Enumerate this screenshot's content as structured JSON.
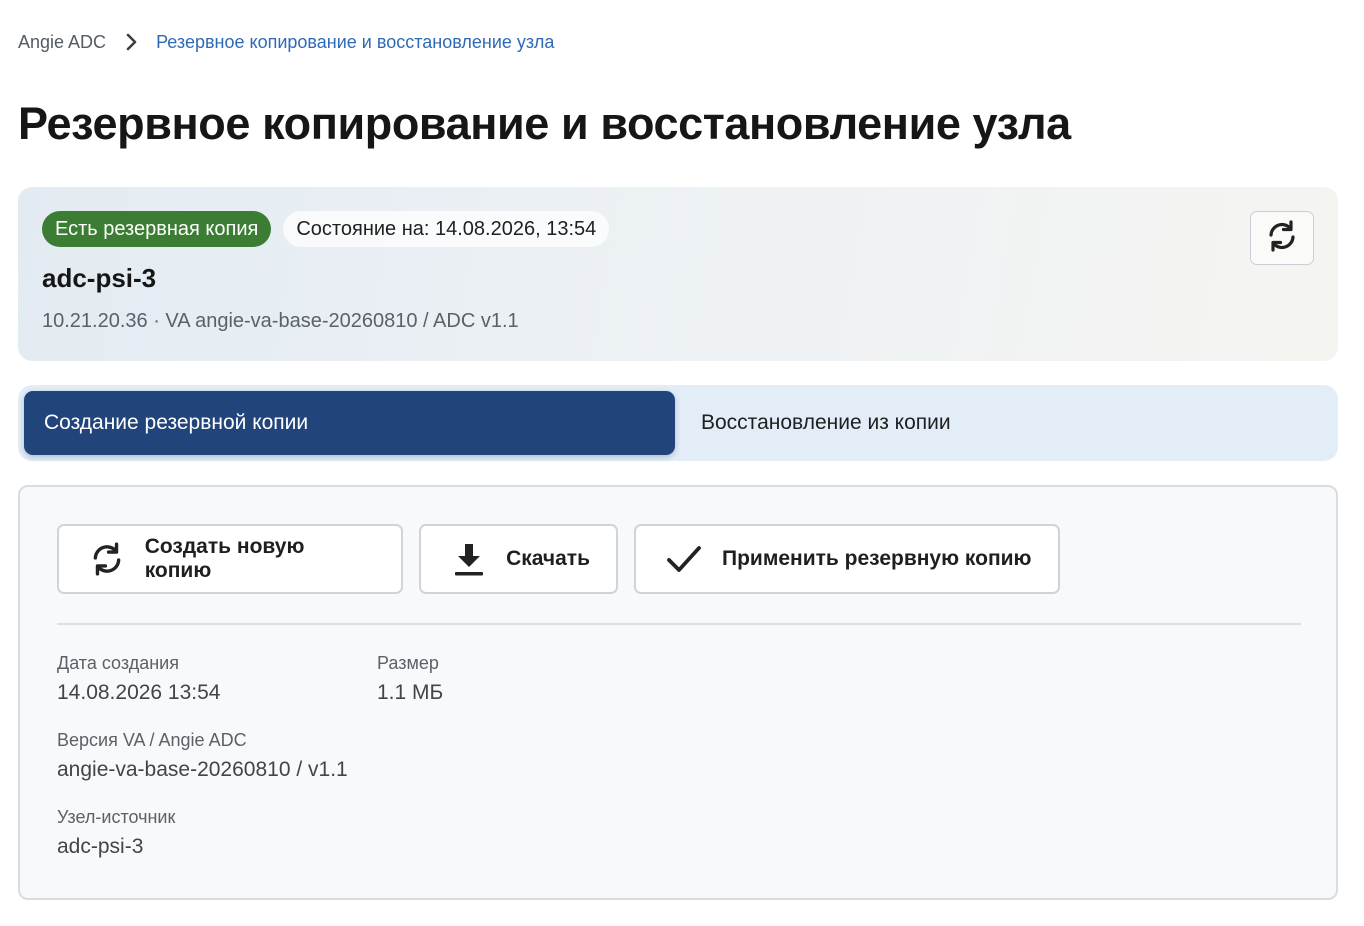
{
  "breadcrumb": {
    "root": "Angie ADC",
    "current": "Резервное копирование и восстановление узла"
  },
  "page_title": "Резервное копирование и восстановление узла",
  "node": {
    "backup_badge": "Есть резервная копия",
    "status": "Состояние на: 14.08.2026, 13:54",
    "name": "adc-psi-3",
    "meta": "10.21.20.36 · VA angie-va-base-20260810 / ADC v1.1",
    "refresh_icon": "refresh-icon"
  },
  "tabs": {
    "create": "Создание резервной копии",
    "restore": "Восстановление из копии",
    "active": "create"
  },
  "actions": {
    "create": {
      "label": "Создать новую копию",
      "icon": "refresh-icon"
    },
    "download": {
      "label": "Скачать",
      "icon": "download-icon"
    },
    "apply": {
      "label": "Применить резервную копию",
      "icon": "check-icon"
    }
  },
  "details": {
    "created_label": "Дата создания",
    "created_value": "14.08.2026 13:54",
    "size_label": "Размер",
    "size_value": "1.1 МБ",
    "version_label": "Версия VA / Angie ADC",
    "version_value": "angie-va-base-20260810 / v1.1",
    "source_label": "Узел-источник",
    "source_value": "adc-psi-3"
  },
  "colors": {
    "badge_green": "#3b7d33",
    "tab_active": "#21447a",
    "tab_bar": "#e3edf8",
    "link": "#2f6ab5"
  }
}
